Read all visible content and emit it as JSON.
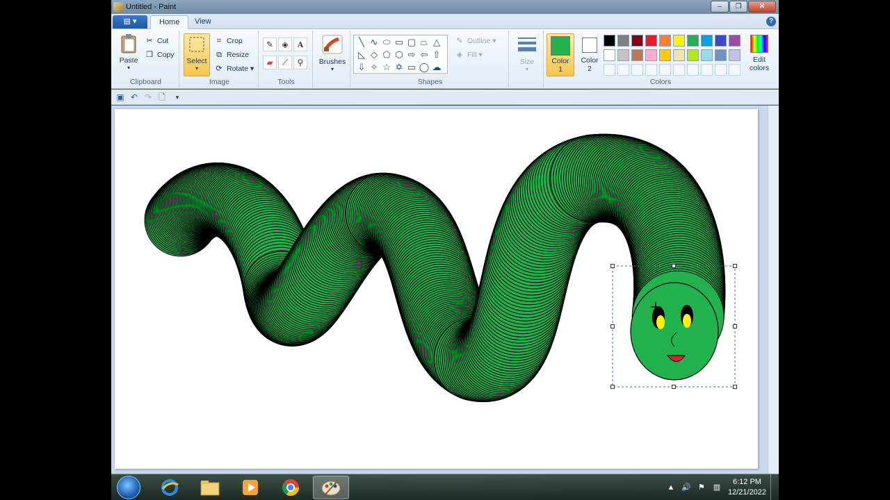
{
  "window": {
    "title": "Untitled - Paint"
  },
  "tabs": {
    "home": "Home",
    "view": "View"
  },
  "clipboard": {
    "paste": "Paste",
    "cut": "Cut",
    "copy": "Copy",
    "label": "Clipboard"
  },
  "image": {
    "select": "Select",
    "crop": "Crop",
    "resize": "Resize",
    "rotate": "Rotate",
    "label": "Image"
  },
  "tools": {
    "label": "Tools"
  },
  "brushes": {
    "label": "Brushes"
  },
  "shapes": {
    "label": "Shapes",
    "outline": "Outline",
    "fill": "Fill"
  },
  "size": {
    "label": "Size"
  },
  "colors": {
    "color1_label": "Color",
    "color1_num": "1",
    "color2_label": "Color",
    "color2_num": "2",
    "edit_label": "Edit",
    "edit_label2": "colors",
    "label": "Colors",
    "color1": "#22b14c",
    "color2": "#ffffff",
    "palette_row1": [
      "#000000",
      "#7f7f7f",
      "#880015",
      "#ed1c24",
      "#ff7f27",
      "#fff200",
      "#22b14c",
      "#00a2e8",
      "#3f48cc",
      "#a349a4"
    ],
    "palette_row2": [
      "#ffffff",
      "#c3c3c3",
      "#b97a57",
      "#ffaec9",
      "#ffc90e",
      "#efe4b0",
      "#b5e61d",
      "#99d9ea",
      "#7092be",
      "#c8bfe7"
    ]
  },
  "taskbar": {
    "time": "6:12 PM",
    "date": "12/21/2022"
  },
  "drawing": {
    "worm_color": "#22b14c",
    "eye_color": "#fff200",
    "mouth_color": "#ed1c24"
  }
}
